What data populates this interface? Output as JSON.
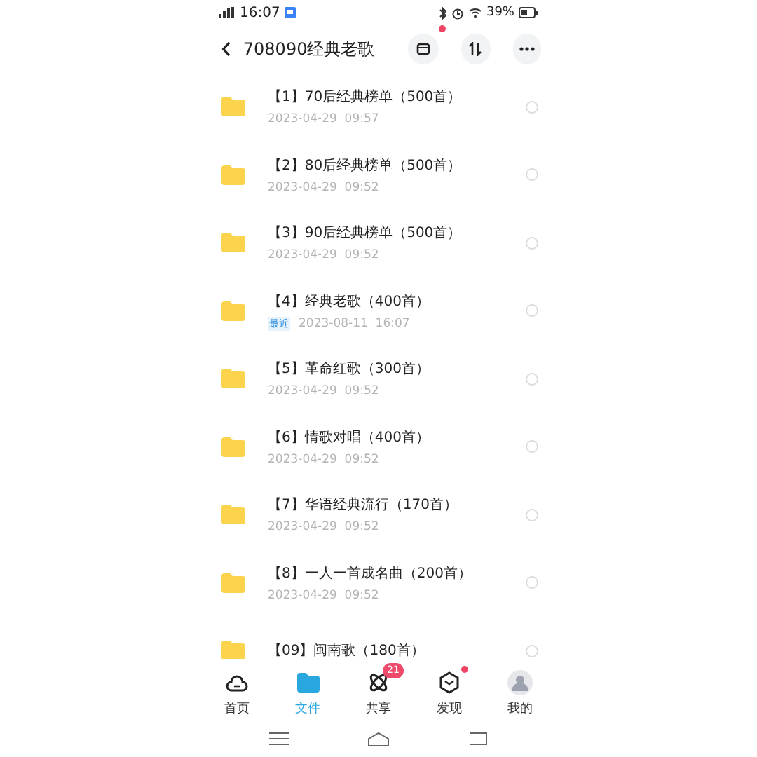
{
  "status_bar": {
    "time": "16:07",
    "battery": "39%"
  },
  "header": {
    "title": "708090经典老歌",
    "notification_dot": true
  },
  "files": [
    {
      "name": "【1】70后经典榜单（500首）",
      "date": "2023-04-29  09:57",
      "checked": false
    },
    {
      "name": "【2】80后经典榜单（500首）",
      "date": "2023-04-29  09:52",
      "checked": false
    },
    {
      "name": "【3】90后经典榜单（500首）",
      "date": "2023-04-29  09:52",
      "checked": false
    },
    {
      "name": "【4】经典老歌（400首）",
      "tag": "最近",
      "date": "2023-08-11  16:07",
      "checked": false
    },
    {
      "name": "【5】革命红歌（300首）",
      "date": "2023-04-29  09:52",
      "checked": false
    },
    {
      "name": "【6】情歌对唱（400首）",
      "date": "2023-04-29  09:52",
      "checked": false
    },
    {
      "name": "【7】华语经典流行（170首）",
      "date": "2023-04-29  09:52",
      "checked": false
    },
    {
      "name": "【8】一人一首成名曲（200首）",
      "date": "2023-04-29  09:52",
      "checked": false
    },
    {
      "name": "【09】闽南歌（180首）",
      "checked": false
    }
  ],
  "tabs": [
    {
      "label": "首页",
      "kind": "cloud",
      "selected": false,
      "dot": false
    },
    {
      "label": "文件",
      "kind": "folder",
      "selected": true,
      "dot": false
    },
    {
      "label": "共享",
      "kind": "share",
      "selected": false,
      "badge": "21",
      "dot": false
    },
    {
      "label": "发现",
      "kind": "discover",
      "selected": false,
      "dot": true
    },
    {
      "label": "我的",
      "kind": "avatar",
      "selected": false,
      "dot": false
    }
  ]
}
